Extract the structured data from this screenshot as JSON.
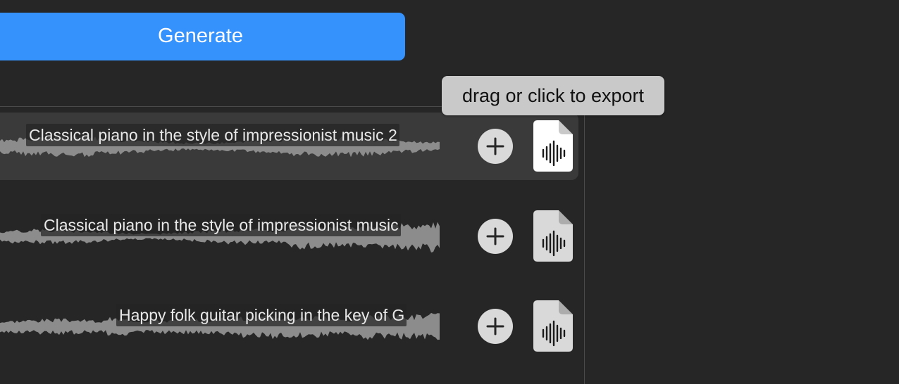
{
  "generate": {
    "label": "Generate",
    "color": "#3592fd"
  },
  "tooltip": {
    "text": "drag or click to export"
  },
  "tracks": [
    {
      "title": "Classical piano in the style of impressionist music 2",
      "selected": true
    },
    {
      "title": "Classical piano in the style of impressionist music",
      "selected": false
    },
    {
      "title": "Happy folk guitar picking in the key of G",
      "selected": false
    }
  ],
  "icons": {
    "add": "plus-circle-icon",
    "export": "audio-file-icon"
  },
  "colors": {
    "background": "#262626",
    "waveform": "#8c8c8c",
    "selected_row": "#3a3a3a",
    "tooltip": "#c9c9c9"
  }
}
